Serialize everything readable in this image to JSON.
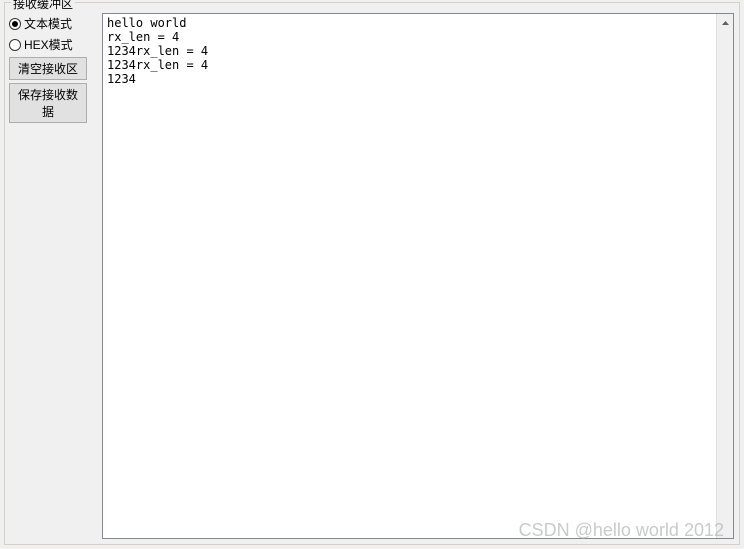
{
  "groupbox": {
    "title": "接收缓冲区"
  },
  "radios": {
    "text_mode": "文本模式",
    "hex_mode": "HEX模式",
    "selected": "text_mode"
  },
  "buttons": {
    "clear": "清空接收区",
    "save": "保存接收数据"
  },
  "buffer_content": "hello world\nrx_len = 4\n1234rx_len = 4\n1234rx_len = 4\n1234",
  "watermark": "CSDN @hello world 2012"
}
